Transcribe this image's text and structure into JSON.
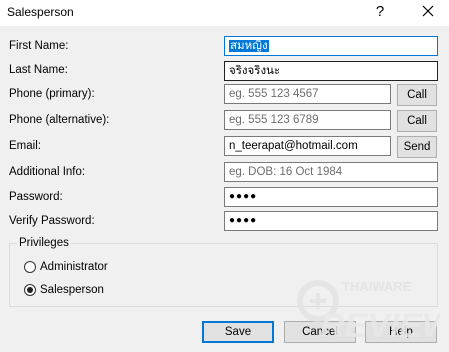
{
  "window": {
    "title": "Salesperson",
    "help_glyph": "?"
  },
  "form": {
    "first_name": {
      "label": "First Name:",
      "value": "สมหญิง"
    },
    "last_name": {
      "label": "Last Name:",
      "value": "จริงจริงนะ"
    },
    "phone_primary": {
      "label": "Phone (primary):",
      "placeholder": "eg. 555 123 4567",
      "button": "Call"
    },
    "phone_alternative": {
      "label": "Phone (alternative):",
      "placeholder": "eg. 555 123 6789",
      "button": "Call"
    },
    "email": {
      "label": "Email:",
      "value": "n_teerapat@hotmail.com",
      "button": "Send"
    },
    "additional_info": {
      "label": "Additional Info:",
      "placeholder": "eg. DOB: 16 Oct 1984"
    },
    "password": {
      "label": "Password:",
      "value": "●●●●"
    },
    "verify_password": {
      "label": "Verify Password:",
      "value": "●●●●"
    }
  },
  "privileges": {
    "label": "Privileges",
    "options": [
      {
        "label": "Administrator",
        "selected": false
      },
      {
        "label": "Salesperson",
        "selected": true
      }
    ]
  },
  "buttons": {
    "save": "Save",
    "cancel": "Cancel",
    "help": "Help"
  },
  "watermark": {
    "line1": "THAIWARE",
    "line2": "REVIEW"
  },
  "colors": {
    "focus_border": "#0078d7",
    "selection": "#0078d7",
    "background": "#f0f0f0"
  }
}
